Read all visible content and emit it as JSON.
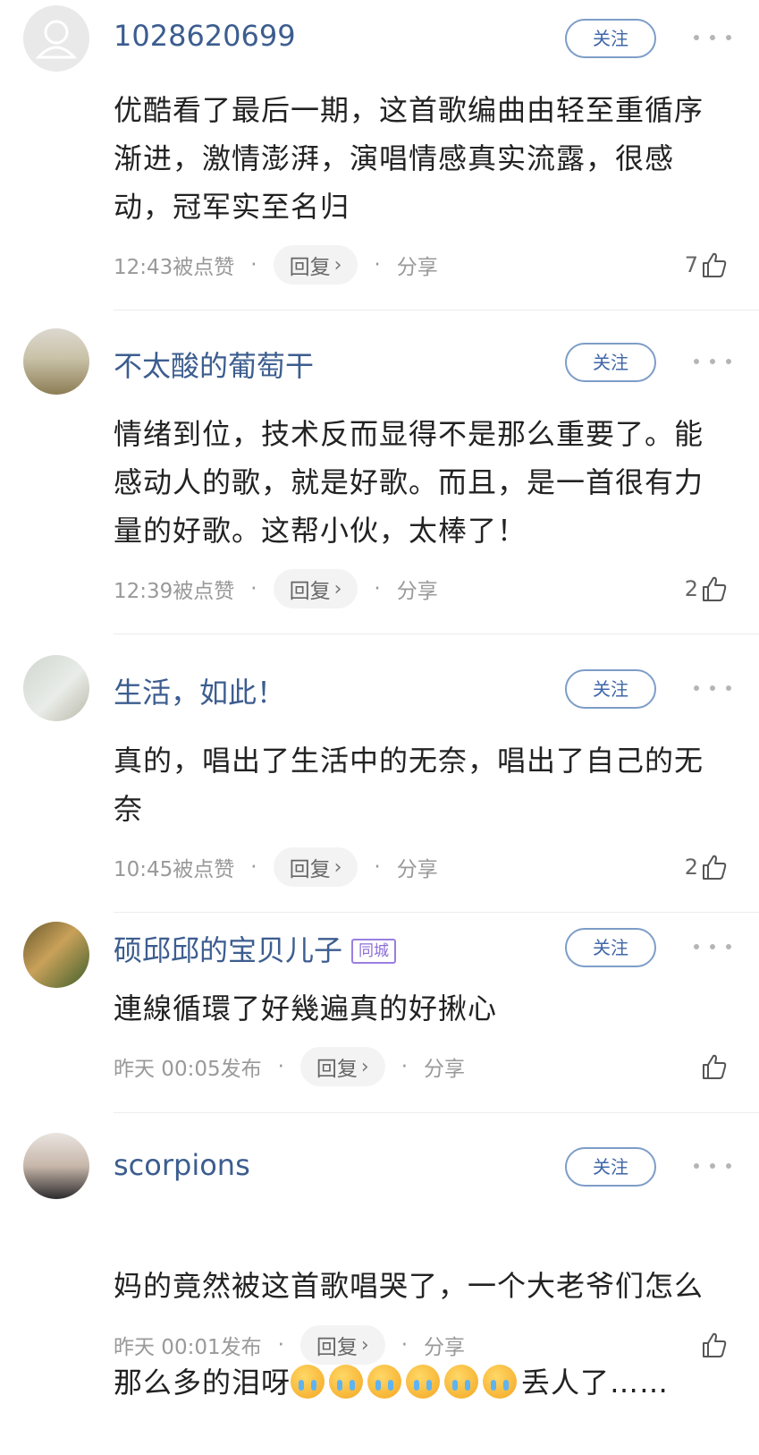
{
  "comments": [
    {
      "username": "1028620699",
      "follow_label": "关注",
      "text": "优酷看了最后一期，这首歌编曲由轻至重循序\n渐进，激情澎湃，演唱情感真实流露，很感\n动，冠军实至名归",
      "time": "12:43被点赞",
      "reply_label": "回复",
      "share_label": "分享",
      "likes": "7"
    },
    {
      "username": "不太酸的葡萄干",
      "follow_label": "关注",
      "text": "情绪到位，技术反而显得不是那么重要了。能\n感动人的歌，就是好歌。而且，是一首很有力\n量的好歌。这帮小伙，太棒了！",
      "time": "12:39被点赞",
      "reply_label": "回复",
      "share_label": "分享",
      "likes": "2"
    },
    {
      "username": "生活，如此！",
      "follow_label": "关注",
      "text": "真的，唱出了生活中的无奈，唱出了自己的无\n奈",
      "time": "10:45被点赞",
      "reply_label": "回复",
      "share_label": "分享",
      "likes": "2"
    },
    {
      "username": "硕邱邱的宝贝儿子",
      "badge": "同城",
      "follow_label": "关注",
      "text": "連線循環了好幾遍真的好揪心",
      "time": "昨天 00:05发布",
      "reply_label": "回复",
      "share_label": "分享",
      "likes": ""
    },
    {
      "username": "scorpions",
      "follow_label": "关注",
      "text_line1": "妈的竟然被这首歌唱哭了，一个大老爷们怎么",
      "text_line2_prefix": "那么多的泪呀",
      "text_line2_suffix": "丢人了……",
      "emoji_name": "crying-emoji",
      "emoji_count": 6,
      "time": "昨天 00:01发布",
      "reply_label": "回复",
      "share_label": "分享",
      "likes": ""
    }
  ]
}
